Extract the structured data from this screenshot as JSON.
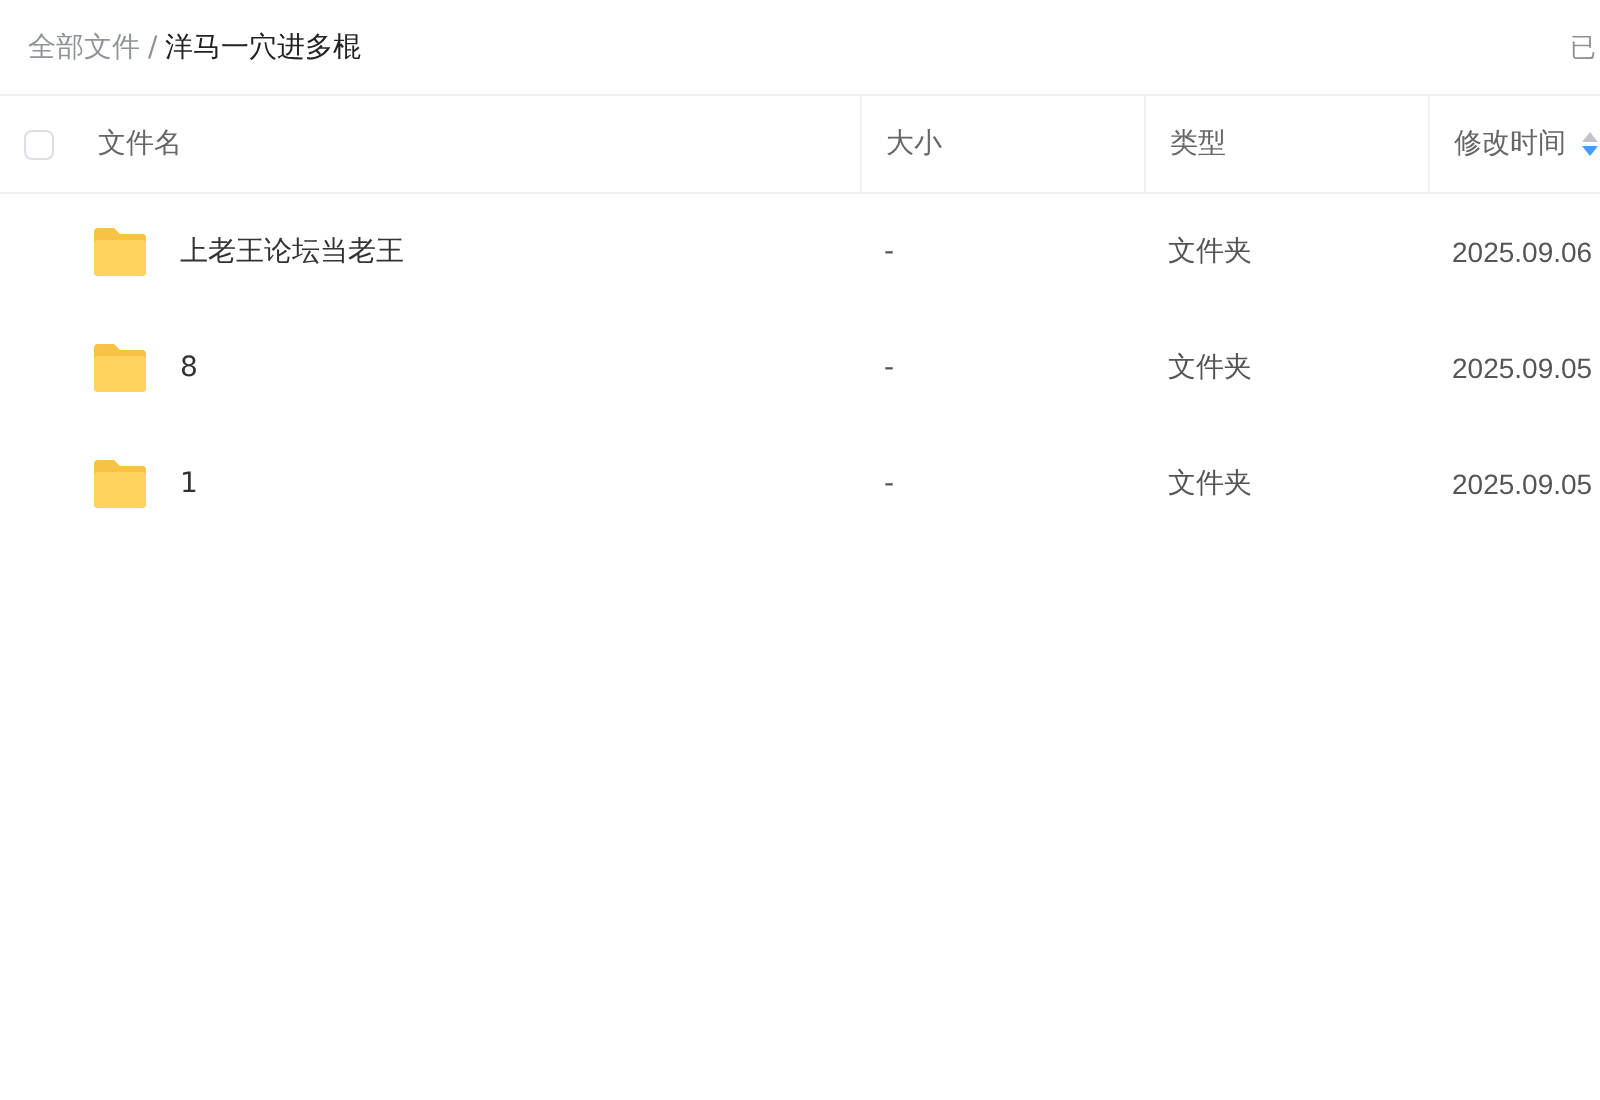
{
  "breadcrumb": {
    "root": "全部文件",
    "separator": "/",
    "current": "洋马一穴进多棍"
  },
  "top_right_text": "已",
  "table": {
    "select_all": {
      "checked": false
    },
    "columns": [
      "文件名",
      "大小",
      "类型",
      "修改时间"
    ],
    "rows": [
      {
        "name": "上老王论坛当老王",
        "size": "-",
        "type": "文件夹",
        "modified": "2025.09.06"
      },
      {
        "name": "8",
        "size": "-",
        "type": "文件夹",
        "modified": "2025.09.05"
      },
      {
        "name": "1",
        "size": "-",
        "type": "文件夹",
        "modified": "2025.09.05"
      }
    ]
  }
}
